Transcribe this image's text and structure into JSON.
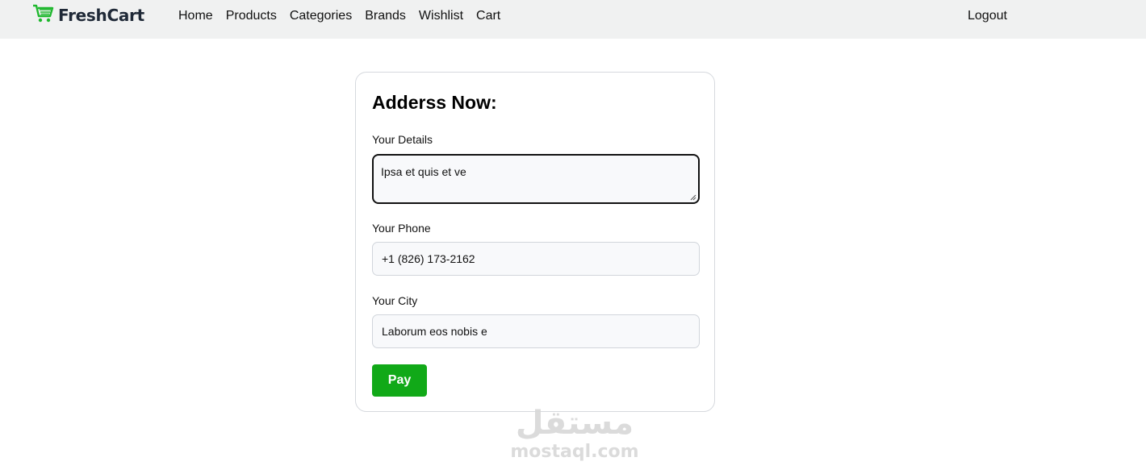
{
  "brand": {
    "name": "FreshCart",
    "icon": "shopping-cart-icon",
    "color": "#1fb82e"
  },
  "nav": {
    "links": [
      "Home",
      "Products",
      "Categories",
      "Brands",
      "Wishlist",
      "Cart"
    ],
    "logout": "Logout"
  },
  "form": {
    "title": "Adderss Now:",
    "details": {
      "label": "Your Details",
      "value": "Ipsa et quis et ve"
    },
    "phone": {
      "label": "Your Phone",
      "value": "+1 (826) 173-2162"
    },
    "city": {
      "label": "Your City",
      "value": "Laborum eos nobis e"
    },
    "pay_label": "Pay",
    "pay_color": "#11a918"
  },
  "watermark": {
    "arabic": "مستقل",
    "latin": "mostaql.com"
  }
}
